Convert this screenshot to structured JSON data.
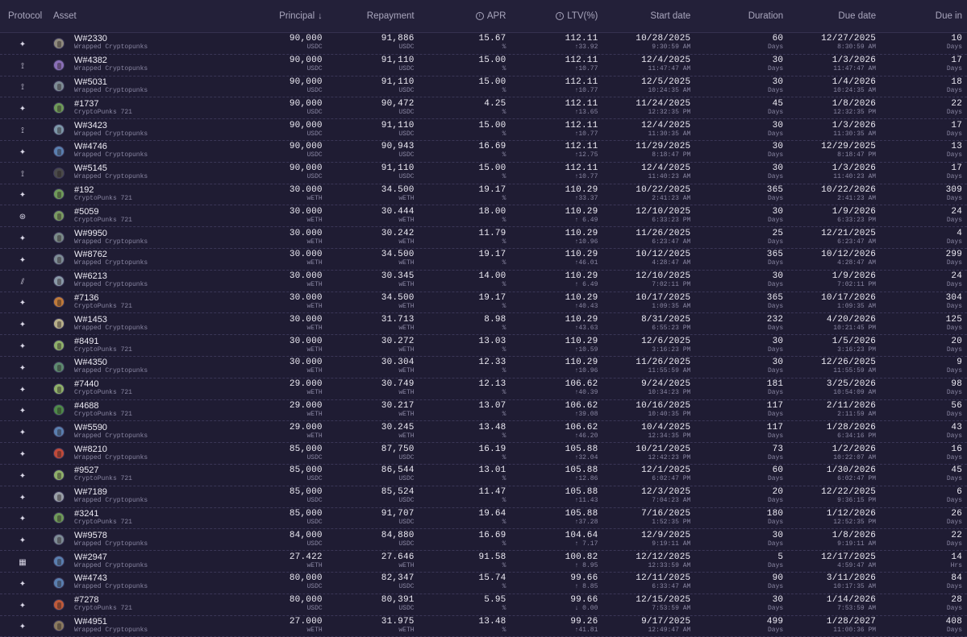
{
  "header": {
    "protocol": "Protocol",
    "asset": "Asset",
    "principal": "Principal",
    "sort_icon": "↓",
    "repayment": "Repayment",
    "apr": "APR",
    "ltv": "LTV(%)",
    "start_date": "Start date",
    "duration": "Duration",
    "due_date": "Due date",
    "due_in": "Due in",
    "info_icon": "i"
  },
  "rows": [
    {
      "proto": "✦",
      "av": "#8f8a7e",
      "name": "W#2330",
      "coll": "Wrapped Cryptopunks",
      "principal": "90,000",
      "pu": "USDC",
      "repay": "91,886",
      "ru": "USDC",
      "apr": "15.67",
      "ltv": "112.11",
      "ltvd": "↑33.92",
      "start": "10/28/2025",
      "start_t": "9:30:59 AM",
      "dur": "60",
      "dur_u": "Days",
      "due": "12/27/2025",
      "due_t": "8:30:59 AM",
      "in": "10",
      "in_u": "Days"
    },
    {
      "proto": "⟟",
      "av": "#8a6fb8",
      "name": "W#4382",
      "coll": "Wrapped Cryptopunks",
      "principal": "90,000",
      "pu": "USDC",
      "repay": "91,110",
      "ru": "USDC",
      "apr": "15.00",
      "ltv": "112.11",
      "ltvd": "↑10.77",
      "start": "12/4/2025",
      "start_t": "11:47:47 AM",
      "dur": "30",
      "dur_u": "Days",
      "due": "1/3/2026",
      "due_t": "11:47:47 AM",
      "in": "17",
      "in_u": "Days"
    },
    {
      "proto": "⟟",
      "av": "#7e8c95",
      "name": "W#5031",
      "coll": "Wrapped Cryptopunks",
      "principal": "90,000",
      "pu": "USDC",
      "repay": "91,110",
      "ru": "USDC",
      "apr": "15.00",
      "ltv": "112.11",
      "ltvd": "↑10.77",
      "start": "12/5/2025",
      "start_t": "10:24:35 AM",
      "dur": "30",
      "dur_u": "Days",
      "due": "1/4/2026",
      "due_t": "10:24:35 AM",
      "in": "18",
      "in_u": "Days"
    },
    {
      "proto": "✦",
      "av": "#6f9a5a",
      "name": "#1737",
      "coll": "CryptoPunks 721",
      "principal": "90,000",
      "pu": "USDC",
      "repay": "90,472",
      "ru": "USDC",
      "apr": "4.25",
      "ltv": "112.11",
      "ltvd": "↑13.65",
      "start": "11/24/2025",
      "start_t": "12:32:35 PM",
      "dur": "45",
      "dur_u": "Days",
      "due": "1/8/2026",
      "due_t": "12:32:35 PM",
      "in": "22",
      "in_u": "Days"
    },
    {
      "proto": "⟟",
      "av": "#7d97a8",
      "name": "W#3423",
      "coll": "Wrapped Cryptopunks",
      "principal": "90,000",
      "pu": "USDC",
      "repay": "91,110",
      "ru": "USDC",
      "apr": "15.00",
      "ltv": "112.11",
      "ltvd": "↑10.77",
      "start": "12/4/2025",
      "start_t": "11:30:35 AM",
      "dur": "30",
      "dur_u": "Days",
      "due": "1/3/2026",
      "due_t": "11:30:35 AM",
      "in": "17",
      "in_u": "Days"
    },
    {
      "proto": "✦",
      "av": "#5a7fb0",
      "name": "W#4746",
      "coll": "Wrapped Cryptopunks",
      "principal": "90,000",
      "pu": "USDC",
      "repay": "90,943",
      "ru": "USDC",
      "apr": "16.69",
      "ltv": "112.11",
      "ltvd": "↑12.75",
      "start": "11/29/2025",
      "start_t": "8:18:47 PM",
      "dur": "30",
      "dur_u": "Days",
      "due": "12/29/2025",
      "due_t": "8:18:47 PM",
      "in": "13",
      "in_u": "Days"
    },
    {
      "proto": "⟟",
      "av": "#4a4a4a",
      "name": "W#5145",
      "coll": "Wrapped Cryptopunks",
      "principal": "90,000",
      "pu": "USDC",
      "repay": "91,110",
      "ru": "USDC",
      "apr": "15.00",
      "ltv": "112.11",
      "ltvd": "↑10.77",
      "start": "12/4/2025",
      "start_t": "11:40:23 AM",
      "dur": "30",
      "dur_u": "Days",
      "due": "1/3/2026",
      "due_t": "11:40:23 AM",
      "in": "17",
      "in_u": "Days"
    },
    {
      "proto": "✦",
      "av": "#6f9a5a",
      "name": "#192",
      "coll": "CryptoPunks 721",
      "principal": "30.000",
      "pu": "wETH",
      "repay": "34.500",
      "ru": "wETH",
      "apr": "19.17",
      "ltv": "110.29",
      "ltvd": "↑33.37",
      "start": "10/22/2025",
      "start_t": "2:41:23 AM",
      "dur": "365",
      "dur_u": "Days",
      "due": "10/22/2026",
      "due_t": "2:41:23 AM",
      "in": "309",
      "in_u": "Days"
    },
    {
      "proto": "⊛",
      "av": "#7a9a62",
      "name": "#5059",
      "coll": "CryptoPunks 721",
      "principal": "30.000",
      "pu": "wETH",
      "repay": "30.444",
      "ru": "wETH",
      "apr": "18.00",
      "ltv": "110.29",
      "ltvd": "↑ 6.49",
      "start": "12/10/2025",
      "start_t": "6:33:23 PM",
      "dur": "30",
      "dur_u": "Days",
      "due": "1/9/2026",
      "due_t": "6:33:23 PM",
      "in": "24",
      "in_u": "Days"
    },
    {
      "proto": "✦",
      "av": "#7a8a88",
      "name": "W#9950",
      "coll": "Wrapped Cryptopunks",
      "principal": "30.000",
      "pu": "wETH",
      "repay": "30.242",
      "ru": "wETH",
      "apr": "11.79",
      "ltv": "110.29",
      "ltvd": "↑10.96",
      "start": "11/26/2025",
      "start_t": "6:23:47 AM",
      "dur": "25",
      "dur_u": "Days",
      "due": "12/21/2025",
      "due_t": "6:23:47 AM",
      "in": "4",
      "in_u": "Days"
    },
    {
      "proto": "✦",
      "av": "#7e8c95",
      "name": "W#8762",
      "coll": "Wrapped Cryptopunks",
      "principal": "30.000",
      "pu": "wETH",
      "repay": "34.500",
      "ru": "wETH",
      "apr": "19.17",
      "ltv": "110.29",
      "ltvd": "↑46.01",
      "start": "10/12/2025",
      "start_t": "4:28:47 AM",
      "dur": "365",
      "dur_u": "Days",
      "due": "10/12/2026",
      "due_t": "4:28:47 AM",
      "in": "299",
      "in_u": "Days"
    },
    {
      "proto": "⫽",
      "av": "#8a9aa8",
      "name": "W#6213",
      "coll": "Wrapped Cryptopunks",
      "principal": "30.000",
      "pu": "wETH",
      "repay": "30.345",
      "ru": "wETH",
      "apr": "14.00",
      "ltv": "110.29",
      "ltvd": "↑ 6.49",
      "start": "12/10/2025",
      "start_t": "7:02:11 PM",
      "dur": "30",
      "dur_u": "Days",
      "due": "1/9/2026",
      "due_t": "7:02:11 PM",
      "in": "24",
      "in_u": "Days"
    },
    {
      "proto": "✦",
      "av": "#c07a3a",
      "name": "#7136",
      "coll": "CryptoPunks 721",
      "principal": "30.000",
      "pu": "wETH",
      "repay": "34.500",
      "ru": "wETH",
      "apr": "19.17",
      "ltv": "110.29",
      "ltvd": "↑40.43",
      "start": "10/17/2025",
      "start_t": "1:09:35 AM",
      "dur": "365",
      "dur_u": "Days",
      "due": "10/17/2026",
      "due_t": "1:09:35 AM",
      "in": "304",
      "in_u": "Days"
    },
    {
      "proto": "✦",
      "av": "#b8b08a",
      "name": "W#1453",
      "coll": "Wrapped Cryptopunks",
      "principal": "30.000",
      "pu": "wETH",
      "repay": "31.713",
      "ru": "wETH",
      "apr": "8.98",
      "ltv": "110.29",
      "ltvd": "↑43.63",
      "start": "8/31/2025",
      "start_t": "6:55:23 PM",
      "dur": "232",
      "dur_u": "Days",
      "due": "4/20/2026",
      "due_t": "10:21:45 PM",
      "in": "125",
      "in_u": "Days"
    },
    {
      "proto": "✦",
      "av": "#8fb06a",
      "name": "#8491",
      "coll": "CryptoPunks 721",
      "principal": "30.000",
      "pu": "wETH",
      "repay": "30.272",
      "ru": "wETH",
      "apr": "13.03",
      "ltv": "110.29",
      "ltvd": "↑10.59",
      "start": "12/6/2025",
      "start_t": "3:16:23 PM",
      "dur": "30",
      "dur_u": "Days",
      "due": "1/5/2026",
      "due_t": "3:16:23 PM",
      "in": "20",
      "in_u": "Days"
    },
    {
      "proto": "✦",
      "av": "#5e8a70",
      "name": "W#4350",
      "coll": "Wrapped Cryptopunks",
      "principal": "30.000",
      "pu": "wETH",
      "repay": "30.304",
      "ru": "wETH",
      "apr": "12.33",
      "ltv": "110.29",
      "ltvd": "↑10.96",
      "start": "11/26/2025",
      "start_t": "11:55:59 AM",
      "dur": "30",
      "dur_u": "Days",
      "due": "12/26/2025",
      "due_t": "11:55:59 AM",
      "in": "9",
      "in_u": "Days"
    },
    {
      "proto": "✦",
      "av": "#8fb06a",
      "name": "#7440",
      "coll": "CryptoPunks 721",
      "principal": "29.000",
      "pu": "wETH",
      "repay": "30.749",
      "ru": "wETH",
      "apr": "12.13",
      "ltv": "106.62",
      "ltvd": "↑40.39",
      "start": "9/24/2025",
      "start_t": "10:34:23 PM",
      "dur": "181",
      "dur_u": "Days",
      "due": "3/25/2026",
      "due_t": "10:54:09 AM",
      "in": "98",
      "in_u": "Days"
    },
    {
      "proto": "✦",
      "av": "#4f8a4a",
      "name": "#4688",
      "coll": "CryptoPunks 721",
      "principal": "29.000",
      "pu": "wETH",
      "repay": "30.217",
      "ru": "wETH",
      "apr": "13.07",
      "ltv": "106.62",
      "ltvd": "↑39.08",
      "start": "10/16/2025",
      "start_t": "10:40:35 PM",
      "dur": "117",
      "dur_u": "Days",
      "due": "2/11/2026",
      "due_t": "2:11:59 AM",
      "in": "56",
      "in_u": "Days"
    },
    {
      "proto": "✦",
      "av": "#5a7fb0",
      "name": "W#5590",
      "coll": "Wrapped Cryptopunks",
      "principal": "29.000",
      "pu": "wETH",
      "repay": "30.245",
      "ru": "wETH",
      "apr": "13.48",
      "ltv": "106.62",
      "ltvd": "↑46.20",
      "start": "10/4/2025",
      "start_t": "12:34:35 PM",
      "dur": "117",
      "dur_u": "Days",
      "due": "1/28/2026",
      "due_t": "6:34:16 PM",
      "in": "43",
      "in_u": "Days"
    },
    {
      "proto": "✦",
      "av": "#c04a3a",
      "name": "W#8210",
      "coll": "Wrapped Cryptopunks",
      "principal": "85,000",
      "pu": "USDC",
      "repay": "87,750",
      "ru": "USDC",
      "apr": "16.19",
      "ltv": "105.88",
      "ltvd": "↑32.04",
      "start": "10/21/2025",
      "start_t": "12:42:23 PM",
      "dur": "73",
      "dur_u": "Days",
      "due": "1/2/2026",
      "due_t": "10:22:07 AM",
      "in": "16",
      "in_u": "Days"
    },
    {
      "proto": "✦",
      "av": "#8fb06a",
      "name": "#9527",
      "coll": "CryptoPunks 721",
      "principal": "85,000",
      "pu": "USDC",
      "repay": "86,544",
      "ru": "USDC",
      "apr": "13.01",
      "ltv": "105.88",
      "ltvd": "↑12.86",
      "start": "12/1/2025",
      "start_t": "6:02:47 PM",
      "dur": "60",
      "dur_u": "Days",
      "due": "1/30/2026",
      "due_t": "6:02:47 PM",
      "in": "45",
      "in_u": "Days"
    },
    {
      "proto": "✦",
      "av": "#9aa0a8",
      "name": "W#7189",
      "coll": "Wrapped Cryptopunks",
      "principal": "85,000",
      "pu": "USDC",
      "repay": "85,524",
      "ru": "USDC",
      "apr": "11.47",
      "ltv": "105.88",
      "ltvd": "↑11.43",
      "start": "12/3/2025",
      "start_t": "7:04:23 AM",
      "dur": "20",
      "dur_u": "Days",
      "due": "12/22/2025",
      "due_t": "9:36:15 PM",
      "in": "6",
      "in_u": "Days"
    },
    {
      "proto": "✦",
      "av": "#6f9a5a",
      "name": "#3241",
      "coll": "CryptoPunks 721",
      "principal": "85,000",
      "pu": "USDC",
      "repay": "91,707",
      "ru": "USDC",
      "apr": "19.64",
      "ltv": "105.88",
      "ltvd": "↑37.28",
      "start": "7/16/2025",
      "start_t": "1:52:35 PM",
      "dur": "180",
      "dur_u": "Days",
      "due": "1/12/2026",
      "due_t": "12:52:35 PM",
      "in": "26",
      "in_u": "Days"
    },
    {
      "proto": "✦",
      "av": "#7e8c95",
      "name": "W#9578",
      "coll": "Wrapped Cryptopunks",
      "principal": "84,000",
      "pu": "USDC",
      "repay": "84,880",
      "ru": "USDC",
      "apr": "16.69",
      "ltv": "104.64",
      "ltvd": "↑ 7.17",
      "start": "12/9/2025",
      "start_t": "9:19:11 AM",
      "dur": "30",
      "dur_u": "Days",
      "due": "1/8/2026",
      "due_t": "9:19:11 AM",
      "in": "22",
      "in_u": "Days"
    },
    {
      "proto": "▦",
      "av": "#5a7fb0",
      "name": "W#2947",
      "coll": "Wrapped Cryptopunks",
      "principal": "27.422",
      "pu": "wETH",
      "repay": "27.646",
      "ru": "wETH",
      "apr": "91.58",
      "ltv": "100.82",
      "ltvd": "↑ 8.95",
      "start": "12/12/2025",
      "start_t": "12:33:59 AM",
      "dur": "5",
      "dur_u": "Days",
      "due": "12/17/2025",
      "due_t": "4:59:47 AM",
      "in": "14",
      "in_u": "Hrs"
    },
    {
      "proto": "✦",
      "av": "#5a7fb0",
      "name": "W#4743",
      "coll": "Wrapped Cryptopunks",
      "principal": "80,000",
      "pu": "USDC",
      "repay": "82,347",
      "ru": "USDC",
      "apr": "15.74",
      "ltv": "99.66",
      "ltvd": "↑ 8.85",
      "start": "12/11/2025",
      "start_t": "6:33:47 AM",
      "dur": "90",
      "dur_u": "Days",
      "due": "3/11/2026",
      "due_t": "10:17:35 AM",
      "in": "84",
      "in_u": "Days"
    },
    {
      "proto": "✦",
      "av": "#c05a3a",
      "name": "#7278",
      "coll": "CryptoPunks 721",
      "principal": "80,000",
      "pu": "USDC",
      "repay": "80,391",
      "ru": "USDC",
      "apr": "5.95",
      "ltv": "99.66",
      "ltvd": "↓ 0.00",
      "start": "12/15/2025",
      "start_t": "7:53:59 AM",
      "dur": "30",
      "dur_u": "Days",
      "due": "1/14/2026",
      "due_t": "7:53:59 AM",
      "in": "28",
      "in_u": "Days"
    },
    {
      "proto": "✦",
      "av": "#8a7a60",
      "name": "W#4951",
      "coll": "Wrapped Cryptopunks",
      "principal": "27.000",
      "pu": "wETH",
      "repay": "31.975",
      "ru": "wETH",
      "apr": "13.48",
      "ltv": "99.26",
      "ltvd": "↑41.81",
      "start": "9/17/2025",
      "start_t": "12:49:47 AM",
      "dur": "499",
      "dur_u": "Days",
      "due": "1/28/2027",
      "due_t": "11:00:36 PM",
      "in": "408",
      "in_u": "Days"
    }
  ]
}
